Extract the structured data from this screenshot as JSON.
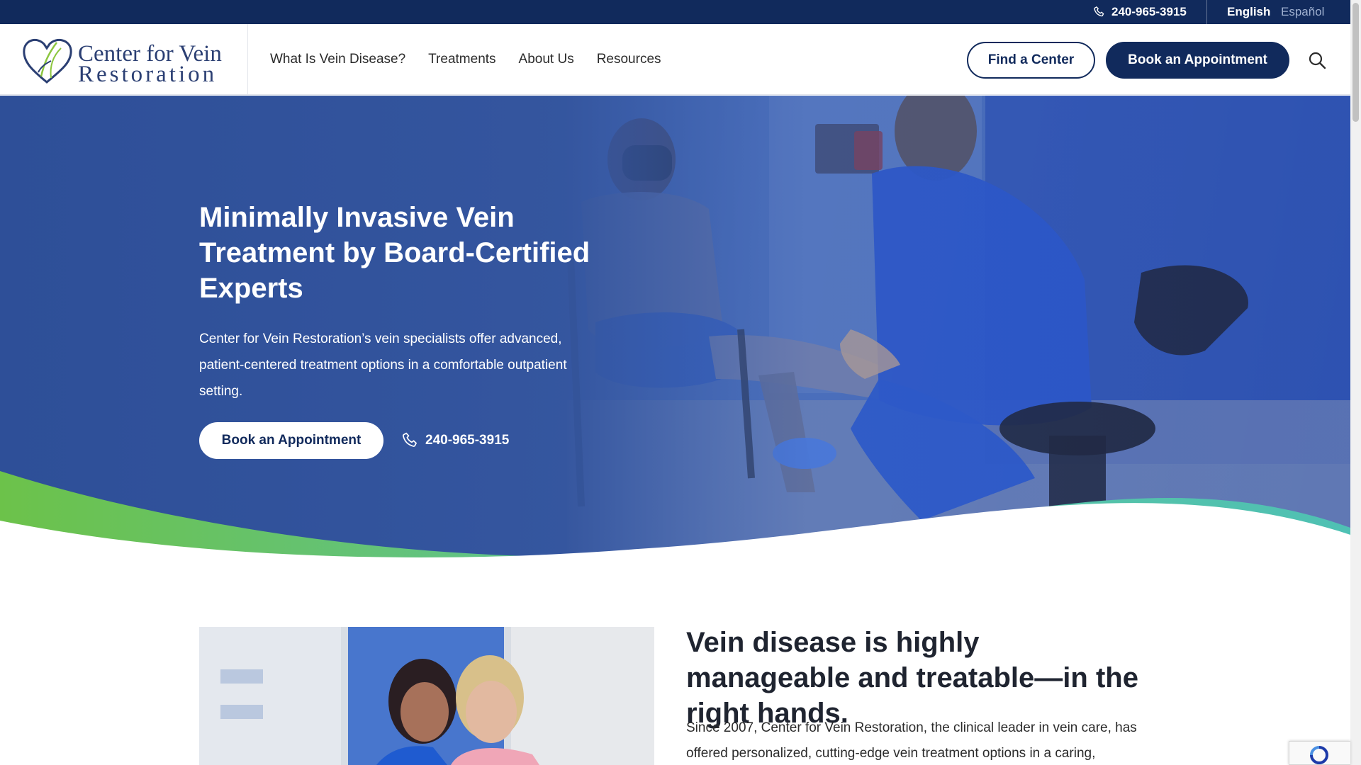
{
  "topbar": {
    "phone": "240-965-3915",
    "lang_english": "English",
    "lang_spanish": "Español"
  },
  "header": {
    "logo_line1": "Center for Vein",
    "logo_line2": "Restoration",
    "nav": [
      {
        "label": "What Is Vein Disease?"
      },
      {
        "label": "Treatments"
      },
      {
        "label": "About Us"
      },
      {
        "label": "Resources"
      }
    ],
    "find_center": "Find a Center",
    "book_appointment": "Book an Appointment"
  },
  "hero": {
    "title": "Minimally Invasive Vein Treatment by Board-Certified Experts",
    "subtitle": "Center for Vein Restoration’s vein specialists offer advanced, patient-centered treatment options in a comfortable outpatient setting.",
    "book_button": "Book an Appointment",
    "phone": "240-965-3915"
  },
  "intro": {
    "title": "Vein disease is highly manageable and treatable—in the right hands.",
    "text": "Since 2007, Center for Vein Restoration, the clinical leader in vein care, has offered personalized, cutting-edge vein treatment options in a caring,"
  },
  "colors": {
    "navy": "#112a5c",
    "hero_blue": "#3a5fae",
    "wave_green": "#6cc24a",
    "wave_teal": "#4fc1b4"
  }
}
